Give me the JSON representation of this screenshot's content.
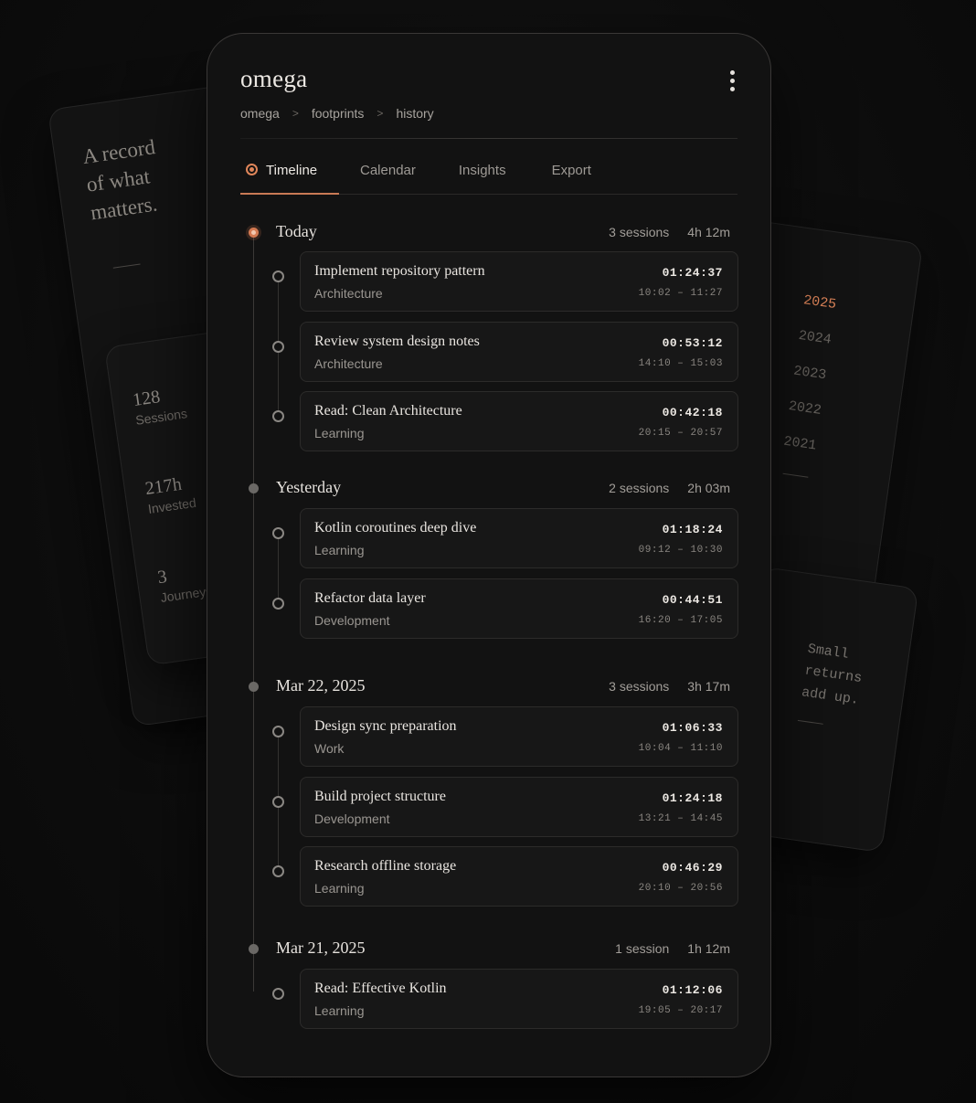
{
  "background": {
    "quote": "A record\nof what\nmatters.",
    "stats": [
      {
        "value": "128",
        "label": "Sessions"
      },
      {
        "value": "217h",
        "label": "Invested"
      },
      {
        "value": "3",
        "label": "Journeys"
      }
    ],
    "years": [
      "2025",
      "2024",
      "2023",
      "2022",
      "2021"
    ],
    "small_quote": "Small\nreturns\nadd up."
  },
  "header": {
    "title": "omega",
    "breadcrumb": [
      "omega",
      "footprints",
      "history"
    ],
    "breadcrumb_sep": ">"
  },
  "tabs": [
    {
      "label": "Timeline",
      "active": true
    },
    {
      "label": "Calendar",
      "active": false
    },
    {
      "label": "Insights",
      "active": false
    },
    {
      "label": "Export",
      "active": false
    }
  ],
  "colors": {
    "accent": "#e0865a",
    "background": "#121212",
    "card": "#171717"
  },
  "groups": [
    {
      "title": "Today",
      "sessions": "3 sessions",
      "total": "4h 12m",
      "entries": [
        {
          "name": "Implement repository pattern",
          "category": "Architecture",
          "duration": "01:24:37",
          "range": "10:02 – 11:27"
        },
        {
          "name": "Review system design notes",
          "category": "Architecture",
          "duration": "00:53:12",
          "range": "14:10 – 15:03"
        },
        {
          "name": "Read: Clean Architecture",
          "category": "Learning",
          "duration": "00:42:18",
          "range": "20:15 – 20:57"
        }
      ]
    },
    {
      "title": "Yesterday",
      "sessions": "2 sessions",
      "total": "2h 03m",
      "entries": [
        {
          "name": "Kotlin coroutines deep dive",
          "category": "Learning",
          "duration": "01:18:24",
          "range": "09:12 – 10:30"
        },
        {
          "name": "Refactor data layer",
          "category": "Development",
          "duration": "00:44:51",
          "range": "16:20 – 17:05"
        }
      ]
    },
    {
      "title": "Mar 22, 2025",
      "sessions": "3 sessions",
      "total": "3h 17m",
      "entries": [
        {
          "name": "Design sync preparation",
          "category": "Work",
          "duration": "01:06:33",
          "range": "10:04 – 11:10"
        },
        {
          "name": "Build project structure",
          "category": "Development",
          "duration": "01:24:18",
          "range": "13:21 – 14:45"
        },
        {
          "name": "Research offline storage",
          "category": "Learning",
          "duration": "00:46:29",
          "range": "20:10 – 20:56"
        }
      ]
    },
    {
      "title": "Mar 21, 2025",
      "sessions": "1 session",
      "total": "1h 12m",
      "entries": [
        {
          "name": "Read: Effective Kotlin",
          "category": "Learning",
          "duration": "01:12:06",
          "range": "19:05 – 20:17"
        }
      ]
    }
  ]
}
